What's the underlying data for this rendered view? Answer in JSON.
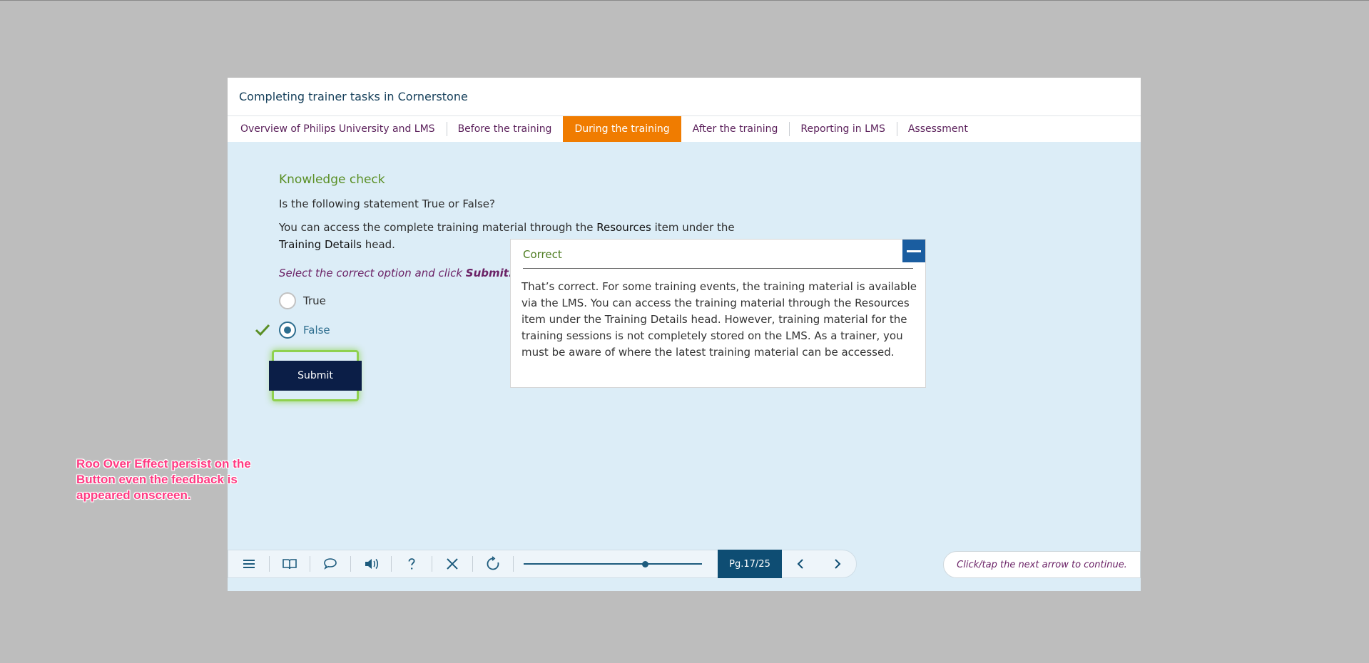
{
  "course": {
    "title": "Completing trainer tasks in Cornerstone",
    "tabs": [
      {
        "label": "Overview of Philips University and LMS",
        "active": false
      },
      {
        "label": "Before the training",
        "active": false
      },
      {
        "label": "During the training",
        "active": true
      },
      {
        "label": "After the training",
        "active": false
      },
      {
        "label": "Reporting in LMS",
        "active": false
      },
      {
        "label": "Assessment",
        "active": false
      }
    ]
  },
  "knowledge_check": {
    "title": "Knowledge check",
    "question": "Is the following statement True or False?",
    "statement_prefix": "You can access the complete training material through the ",
    "statement_term1": "Resources",
    "statement_middle": " item under the ",
    "statement_term2": "Training Details",
    "statement_suffix": " head.",
    "instruction_prefix": "Select the correct option and click ",
    "instruction_action": "Submit.",
    "options": [
      {
        "label": "True",
        "selected": false
      },
      {
        "label": "False",
        "selected": true
      }
    ],
    "submit_label": "Submit"
  },
  "feedback": {
    "title": "Correct",
    "text": "That’s correct. For some training events, the training material is available via the LMS. You can access the training material through the Resources item under the Training Details head. However, training material for the training sessions is not completely stored on the LMS. As a trainer, you must be aware of where the latest training material can be accessed."
  },
  "toolbar": {
    "icons": [
      "menu-icon",
      "book-icon",
      "speech-bubble-icon",
      "speaker-icon",
      "help-icon",
      "close-icon",
      "reload-icon"
    ],
    "progress_fraction": 0.68,
    "page_prefix": "Pg. ",
    "page_current": "17",
    "page_total": "/25",
    "hint": "Click/tap the next arrow to continue."
  },
  "annotation": {
    "text": "Roo Over Effect persist on the Button even the feedback is appeared onscreen."
  },
  "colors": {
    "accent_tab": "#f07c00",
    "submit_bg": "#0b1e47",
    "highlight": "#8fd14f",
    "annotation": "#ff3a82"
  }
}
